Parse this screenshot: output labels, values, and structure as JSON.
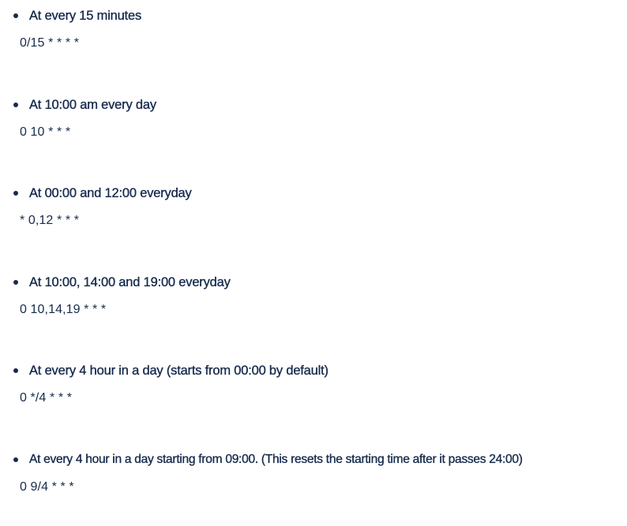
{
  "items": [
    {
      "title": "At every 15 minutes",
      "cron": "0/15 * * * *"
    },
    {
      "title": "At 10:00 am every day",
      "cron": "0 10 * * *"
    },
    {
      "title": "At 00:00 and 12:00 everyday",
      "cron": "* 0,12 * * *"
    },
    {
      "title": "At 10:00, 14:00 and 19:00 everyday",
      "cron": "0 10,14,19 * * *"
    },
    {
      "title": "At every 4 hour in a day (starts from 00:00 by default)",
      "cron": "0 */4 * * *"
    },
    {
      "title": "At every 4 hour in a day starting from 09:00. (This resets the starting time after it passes 24:00)",
      "cron": "0 9/4 * * *"
    }
  ]
}
